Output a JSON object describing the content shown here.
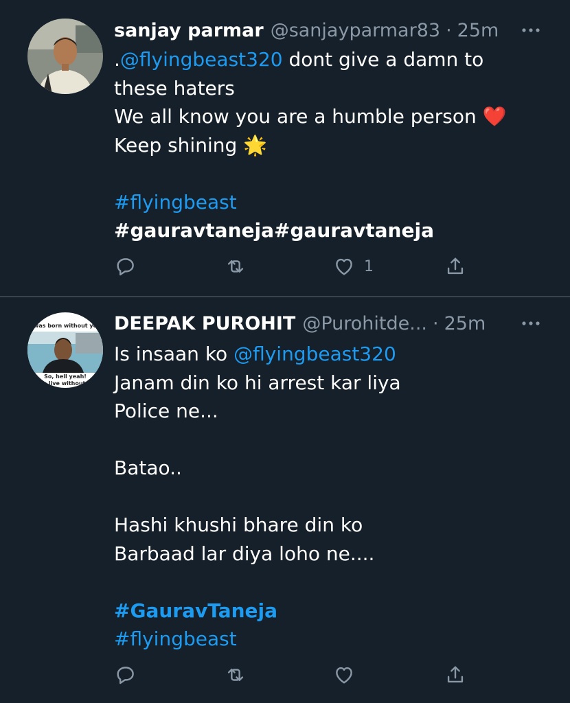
{
  "tweets": [
    {
      "name": "sanjay parmar",
      "handle": "@sanjayparmar83",
      "separator": "·",
      "time": "25m",
      "lines": [
        {
          "parts": [
            {
              "text": ".",
              "style": "text"
            },
            {
              "text": "@flyingbeast320",
              "style": "link"
            },
            {
              "text": " dont give a damn to",
              "style": "text"
            }
          ]
        },
        {
          "parts": [
            {
              "text": "these haters",
              "style": "text"
            }
          ]
        },
        {
          "parts": [
            {
              "text": "We all know you are a humble person ",
              "style": "text"
            },
            {
              "text": "❤️",
              "style": "emoji"
            }
          ]
        },
        {
          "parts": [
            {
              "text": "Keep shining ",
              "style": "text"
            },
            {
              "text": "🌟",
              "style": "emoji"
            }
          ]
        },
        {
          "parts": []
        },
        {
          "parts": [
            {
              "text": "#flyingbeast",
              "style": "hashtag"
            }
          ]
        },
        {
          "parts": [
            {
              "text": "#gauravtaneja#gauravtaneja",
              "style": "bold"
            }
          ]
        }
      ],
      "like_count": "1"
    },
    {
      "name": "DEEPAK PUROHIT",
      "handle": "@Purohitde...",
      "separator": "·",
      "time": "25m",
      "avatar_text": {
        "top": "I was born without you",
        "bottom1": "So, hell yeah!",
        "bottom2": "I can live without you"
      },
      "lines": [
        {
          "parts": [
            {
              "text": "Is insaan ko ",
              "style": "text"
            },
            {
              "text": "@flyingbeast320",
              "style": "link"
            }
          ]
        },
        {
          "parts": [
            {
              "text": "Janam din ko hi arrest kar liya",
              "style": "text"
            }
          ]
        },
        {
          "parts": [
            {
              "text": "Police ne...",
              "style": "text"
            }
          ]
        },
        {
          "parts": []
        },
        {
          "parts": [
            {
              "text": "Batao..",
              "style": "text"
            }
          ]
        },
        {
          "parts": []
        },
        {
          "parts": [
            {
              "text": "Hashi khushi bhare din ko",
              "style": "text"
            }
          ]
        },
        {
          "parts": [
            {
              "text": "Barbaad lar diya loho ne....",
              "style": "text"
            }
          ]
        },
        {
          "parts": []
        },
        {
          "parts": [
            {
              "text": "#GauravTaneja",
              "style": "bold-blue"
            }
          ]
        },
        {
          "parts": [
            {
              "text": "#flyingbeast",
              "style": "hashtag"
            }
          ]
        }
      ],
      "like_count": ""
    }
  ],
  "colors": {
    "background": "#15202b",
    "link": "#1d9bf0",
    "muted": "#8b98a5",
    "divider": "#38444d"
  },
  "icons": [
    "more-icon",
    "reply-icon",
    "retweet-icon",
    "like-icon",
    "share-icon"
  ]
}
